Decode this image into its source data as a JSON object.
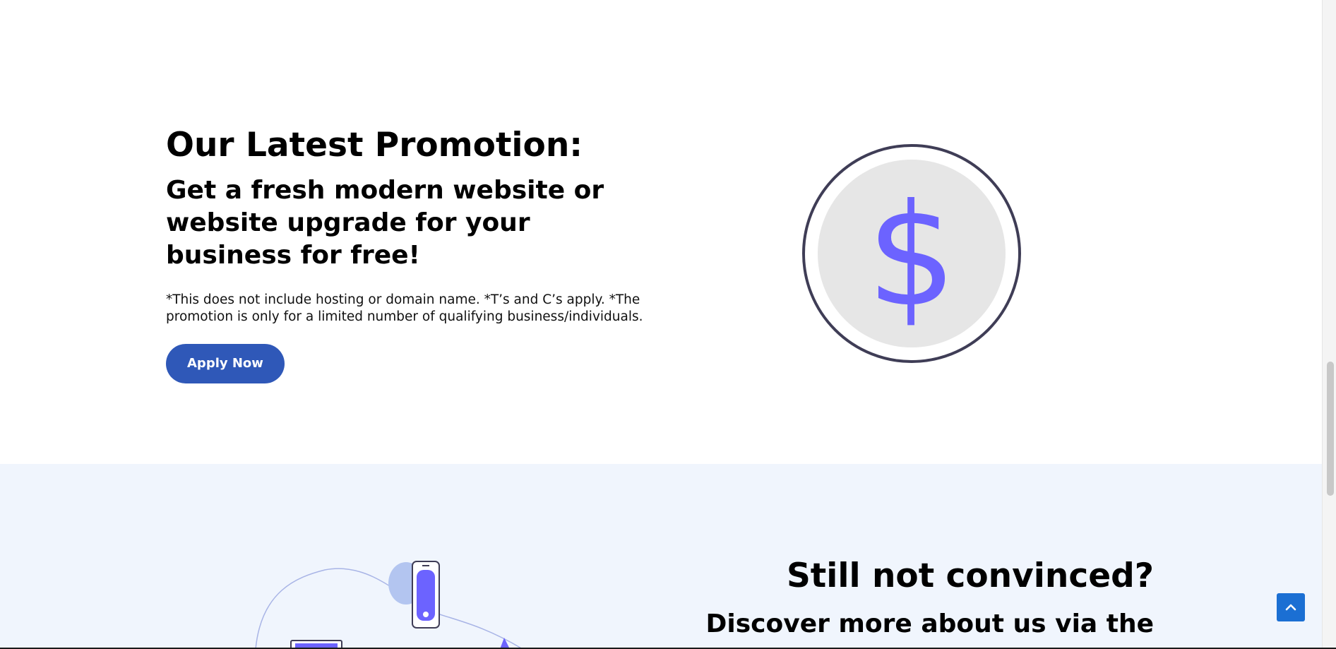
{
  "promo": {
    "title": "Our Latest Promotion:",
    "subtitle": "Get a fresh modern website or website upgrade for your business for free!",
    "note": "*This does not include hosting or domain name. *T’s and C’s apply. *The promotion is only for a limited number of qualifying business/individuals.",
    "apply_label": "Apply Now",
    "coin_symbol": "$",
    "coin_icon": "dollar-coin-icon"
  },
  "convince": {
    "title": "Still not convinced?",
    "subtitle": "Discover more about us via the",
    "illustration_icon": "devices-illustration"
  },
  "back_to_top_icon": "chevron-up-icon",
  "colors": {
    "primary_button": "#2f58b8",
    "coin_accent": "#6c63ff",
    "coin_ring": "#3f3d56",
    "coin_fill": "#e6e6e6",
    "section_bg": "#f0f5fd",
    "back_to_top": "#1b6fd3"
  }
}
